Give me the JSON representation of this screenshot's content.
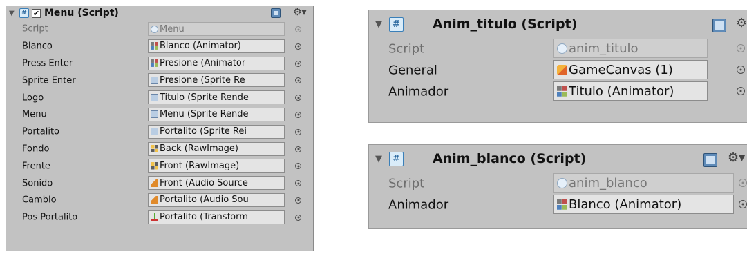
{
  "menu_component": {
    "title": "Menu (Script)",
    "enabled_check": "✔",
    "fields": [
      {
        "label": "Script",
        "value": "Menu",
        "icon": "script-icon"
      },
      {
        "label": "Blanco",
        "value": "Blanco (Animator)",
        "icon": "animator-icon"
      },
      {
        "label": "Press Enter",
        "value": "Presione (Animator",
        "icon": "animator-icon"
      },
      {
        "label": "Sprite Enter",
        "value": "Presione (Sprite Re",
        "icon": "sprite-renderer-icon"
      },
      {
        "label": "Logo",
        "value": "Titulo (Sprite Rende",
        "icon": "sprite-renderer-icon"
      },
      {
        "label": "Menu",
        "value": "Menu (Sprite Rende",
        "icon": "sprite-renderer-icon"
      },
      {
        "label": "Portalito",
        "value": "Portalito (Sprite Rei",
        "icon": "sprite-renderer-icon"
      },
      {
        "label": "Fondo",
        "value": "Back (RawImage)",
        "icon": "raw-image-icon"
      },
      {
        "label": "Frente",
        "value": "Front (RawImage)",
        "icon": "raw-image-icon"
      },
      {
        "label": "Sonido",
        "value": "Front (Audio Source",
        "icon": "audio-source-icon"
      },
      {
        "label": "Cambio",
        "value": "Portalito (Audio Sou",
        "icon": "audio-source-icon"
      },
      {
        "label": "Pos Portalito",
        "value": "Portalito (Transform",
        "icon": "transform-icon"
      }
    ]
  },
  "anim_titulo_component": {
    "title": "Anim_titulo (Script)",
    "fields": [
      {
        "label": "Script",
        "value": "anim_titulo",
        "icon": "script-icon"
      },
      {
        "label": "General",
        "value": "GameCanvas (1)",
        "icon": "gameobject-icon"
      },
      {
        "label": "Animador",
        "value": "Titulo (Animator)",
        "icon": "animator-icon"
      }
    ]
  },
  "anim_blanco_component": {
    "title": "Anim_blanco (Script)",
    "fields": [
      {
        "label": "Script",
        "value": "anim_blanco",
        "icon": "script-icon"
      },
      {
        "label": "Animador",
        "value": "Blanco (Animator)",
        "icon": "animator-icon"
      }
    ]
  },
  "glyphs": {
    "foldout": "▼",
    "cs": "C#",
    "gear": "⚙▾"
  }
}
